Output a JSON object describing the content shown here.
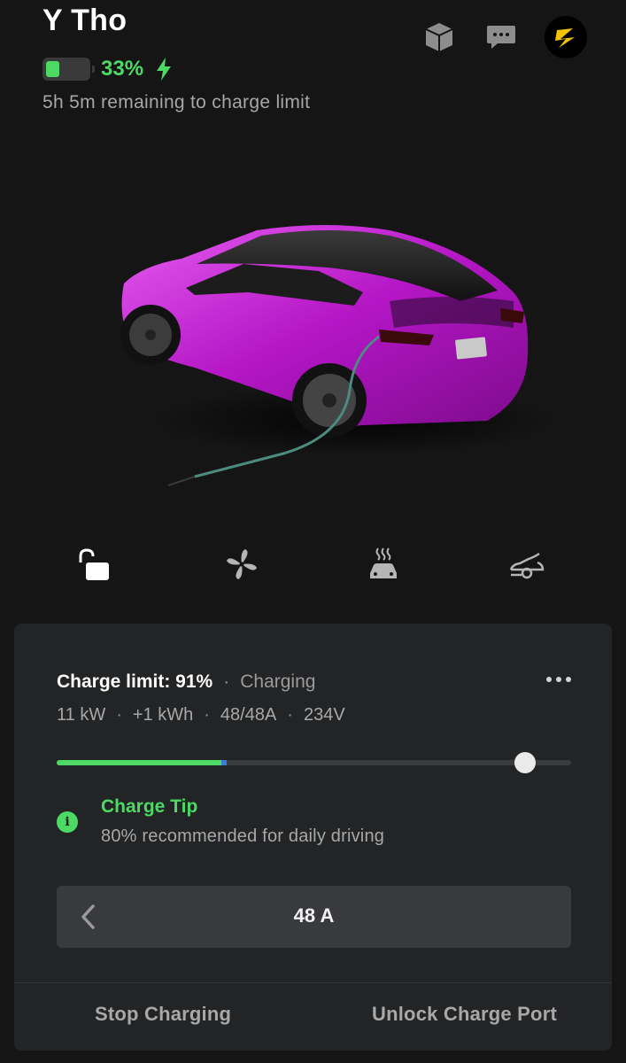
{
  "header": {
    "vehicle_name": "Y Tho",
    "battery_percent_label": "33%",
    "battery_level": 0.33,
    "remaining_text": "5h 5m remaining to charge limit"
  },
  "top_icons": [
    "package-icon",
    "message-icon",
    "profile-avatar"
  ],
  "quick_controls": [
    "lock-icon",
    "fan-icon",
    "seat-heat-icon",
    "frunk-icon"
  ],
  "charge_panel": {
    "limit_label": "Charge limit: 91%",
    "status": "Charging",
    "stats": [
      "11 kW",
      "+1 kWh",
      "48/48A",
      "234V"
    ],
    "slider": {
      "current_percent": 33,
      "limit_percent": 91
    },
    "tip_title": "Charge Tip",
    "tip_text": "80% recommended for daily driving",
    "amps_value": "48 A",
    "stop_button": "Stop Charging",
    "unlock_button": "Unlock Charge Port"
  },
  "colors": {
    "accent_green": "#4cd964",
    "background": "#151515",
    "panel": "#232426",
    "car_body": "#c21fd1"
  }
}
